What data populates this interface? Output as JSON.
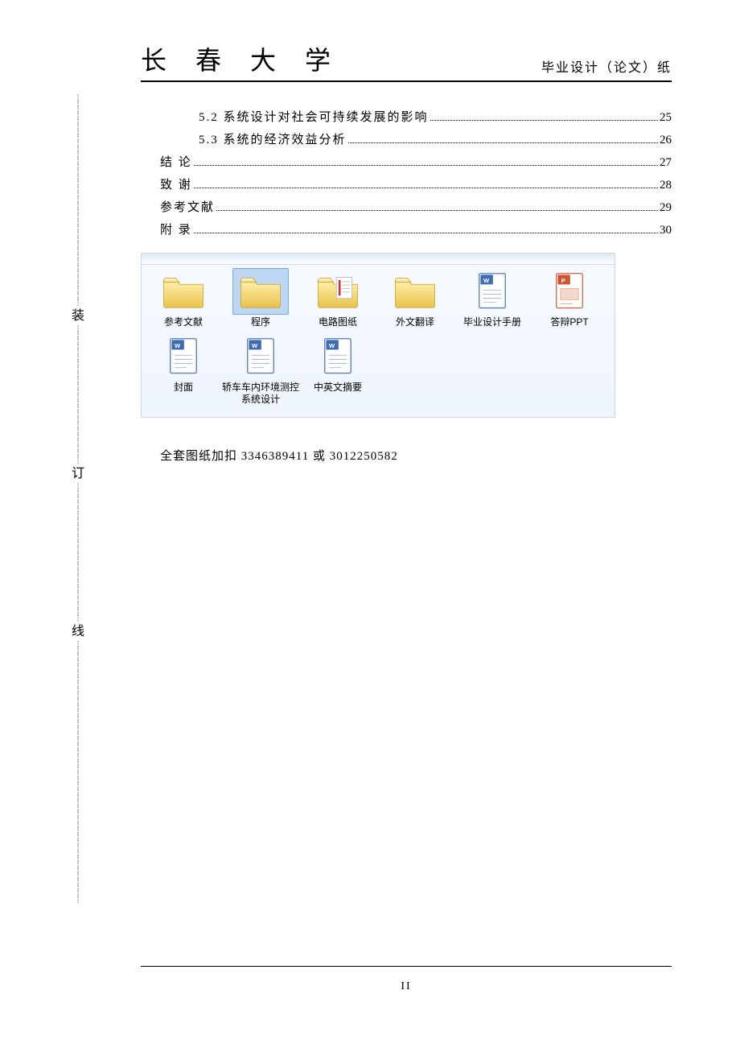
{
  "header": {
    "university": "长 春 大 学",
    "paper_type": "毕业设计（论文）纸"
  },
  "toc": [
    {
      "label": "5.2  系统设计对社会可持续发展的影响",
      "page": "25",
      "indent": 1
    },
    {
      "label": "5.3  系统的经济效益分析",
      "page": "26",
      "indent": 1
    },
    {
      "label": "结    论",
      "page": "27",
      "indent": 0
    },
    {
      "label": "致    谢",
      "page": "28",
      "indent": 0
    },
    {
      "label": "参考文献",
      "page": "29",
      "indent": 0
    },
    {
      "label": "附  录",
      "page": "30",
      "indent": 0
    }
  ],
  "explorer": {
    "items": [
      {
        "label": "参考文献",
        "type": "folder",
        "selected": false
      },
      {
        "label": "程序",
        "type": "folder",
        "selected": true
      },
      {
        "label": "电路图纸",
        "type": "folder-doc",
        "selected": false
      },
      {
        "label": "外文翻译",
        "type": "folder",
        "selected": false
      },
      {
        "label": "毕业设计手册",
        "type": "word",
        "selected": false
      },
      {
        "label": "答辩PPT",
        "type": "ppt",
        "selected": false
      },
      {
        "label": "封面",
        "type": "word",
        "selected": false
      },
      {
        "label": "轿车车内环境测控系统设计",
        "type": "word",
        "selected": false
      },
      {
        "label": "中英文摘要",
        "type": "word",
        "selected": false
      }
    ]
  },
  "note": "全套图纸加扣  3346389411 或 3012250582",
  "page_number": "II",
  "binding": {
    "c1": "装",
    "c2": "订",
    "c3": "线"
  }
}
